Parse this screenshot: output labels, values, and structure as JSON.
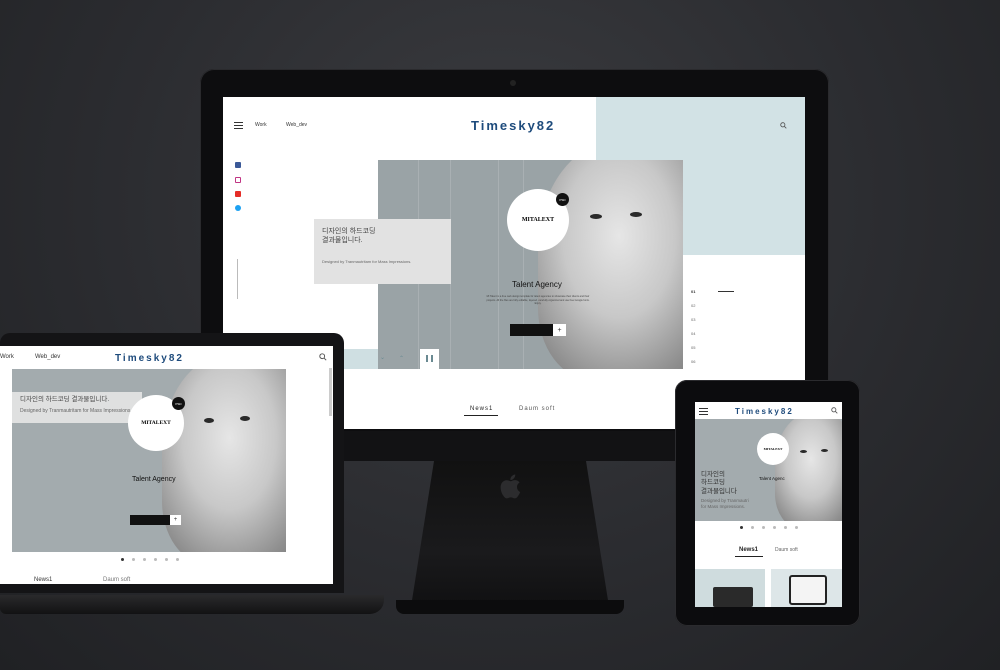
{
  "brand": {
    "logo": "Timesky82"
  },
  "desktop": {
    "nav": [
      "Work",
      "Web_dev"
    ],
    "hero": {
      "korean_1": "디자인의 하드코딩",
      "korean_2": "결과물입니다.",
      "designed_by": "Designed by Tranmautritam for Mass Impressions.",
      "badge_logo": "MITALEXT",
      "badge_tag": "PSD",
      "title": "Talent Agency",
      "description": "MI Talent is a free web design template for talent agencies to showcase their clients and their projects. All the files are fully editable, layered, carefully organized and use free Google fonts. Enjoy."
    },
    "pager": [
      "01",
      "02",
      "03",
      "04",
      "05",
      "06"
    ],
    "tabs": [
      "News1",
      "Daum soft"
    ]
  },
  "laptop": {
    "nav": [
      "Work",
      "Web_dev"
    ],
    "hero": {
      "korean": "디자인의 하드코딩 결과물입니다.",
      "designed_by": "Designed by Tranmautritam for Mass Impressions.",
      "badge_logo": "MITALEXT",
      "badge_tag": "PSD",
      "title": "Talent Agency"
    },
    "tabs": [
      "News1",
      "Daum soft"
    ]
  },
  "tablet": {
    "hero": {
      "korean_1": "디자인의",
      "korean_2": "하드코딩",
      "korean_3": "결과물입니다",
      "designed_by_1": "Designed by Tranmautri",
      "designed_by_2": "for Mass Impressions.",
      "badge_logo": "MITALEXT",
      "title": "Talent Agenc"
    },
    "tabs": [
      "News1",
      "Daum soft"
    ]
  },
  "colors": {
    "accent": "#1e4b7c",
    "panel": "#d2e2e5",
    "hero": "#9aa3a6"
  },
  "icons": [
    "hamburger-icon",
    "search-icon",
    "facebook-icon",
    "instagram-icon",
    "youtube-icon",
    "twitter-icon",
    "chevron-down-icon",
    "chevron-up-icon",
    "pause-icon",
    "plus-icon",
    "apple-logo-icon"
  ]
}
